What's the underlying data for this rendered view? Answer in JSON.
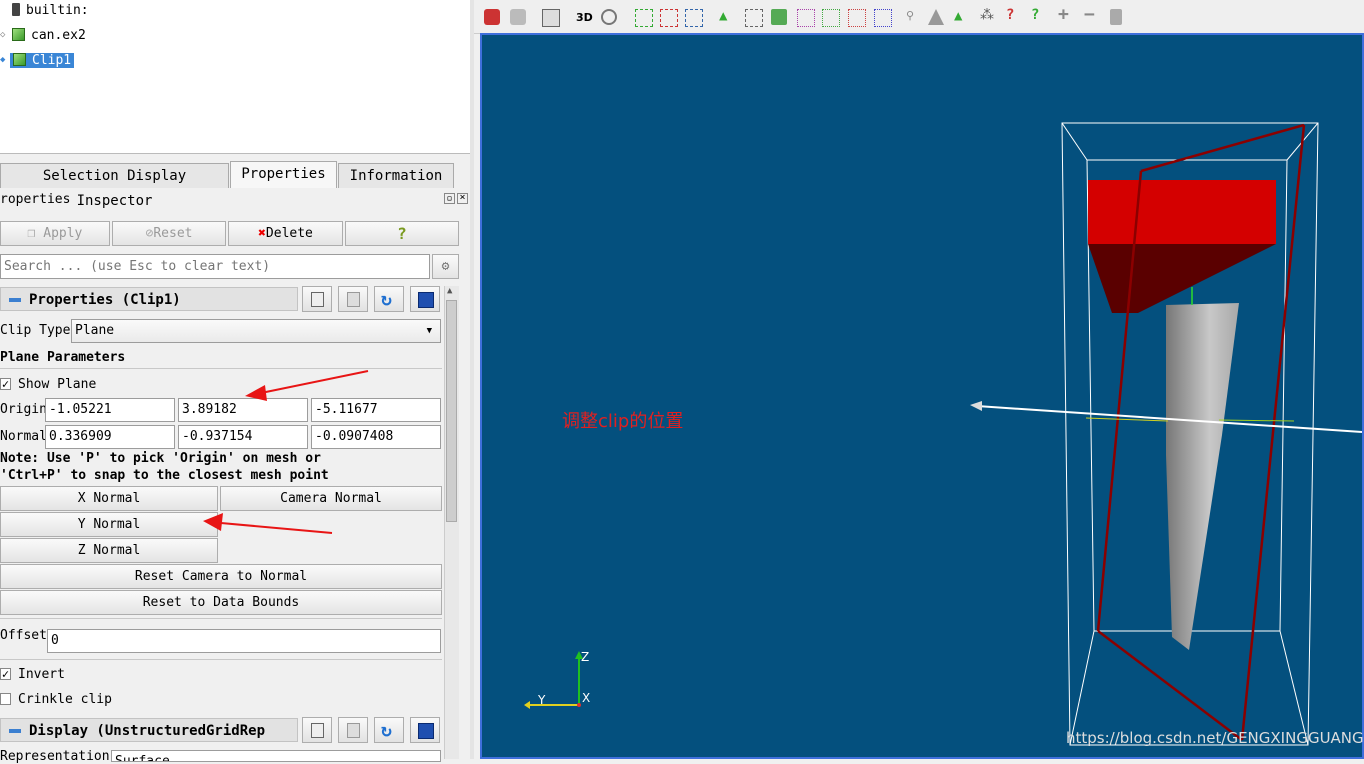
{
  "pipeline": {
    "items": [
      {
        "label": "builtin:"
      },
      {
        "label": "can.ex2"
      },
      {
        "label": "Clip1",
        "selected": true
      }
    ]
  },
  "tabs": [
    {
      "label": "Selection Display Inspector"
    },
    {
      "label": "Properties",
      "active": true
    },
    {
      "label": "Information"
    }
  ],
  "properties_panel": {
    "title": "roperties",
    "apply_label": "Apply",
    "reset_label": "Reset",
    "delete_label": "Delete",
    "help_label": "?",
    "search_placeholder": "Search ... (use Esc to clear text)"
  },
  "section_properties": {
    "title": "Properties (Clip1)"
  },
  "clip_type": {
    "label": "Clip Type",
    "value": "Plane"
  },
  "plane_parameters": {
    "title": "Plane Parameters",
    "show_plane_label": "Show Plane",
    "show_plane_checked": true,
    "origin_label": "Origin",
    "origin": [
      "-1.05221",
      "3.89182",
      "-5.11677"
    ],
    "normal_label": "Normal",
    "normal": [
      "0.336909",
      "-0.937154",
      "-0.0907408"
    ],
    "note_line1": "Note: Use 'P' to pick 'Origin' on mesh or",
    "note_line2": "'Ctrl+P' to snap to the closest mesh point",
    "x_normal": "X Normal",
    "camera_normal": "Camera Normal",
    "y_normal": "Y Normal",
    "z_normal": "Z Normal",
    "reset_camera": "Reset Camera to Normal",
    "reset_bounds": "Reset to Data Bounds"
  },
  "offset": {
    "label": "Offset",
    "value": "0"
  },
  "invert": {
    "label": "Invert",
    "checked": true
  },
  "crinkle": {
    "label": "Crinkle clip",
    "checked": false
  },
  "section_display": {
    "title": "Display (UnstructuredGridRep"
  },
  "representation": {
    "label": "Representation",
    "value": "Surface"
  },
  "toolbar": {
    "view_3d_label": "3D"
  },
  "viewport": {
    "annotation": "调整clip的位置",
    "watermark": "https://blog.csdn.net/GENGXINGGUANG",
    "axis_z": "Z",
    "axis_y": "Y",
    "axis_x": "X",
    "background": "#04507e"
  },
  "colors": {
    "accent": "#3a86d6",
    "annotation_red": "#e02020",
    "clip_red": "#d40000"
  }
}
